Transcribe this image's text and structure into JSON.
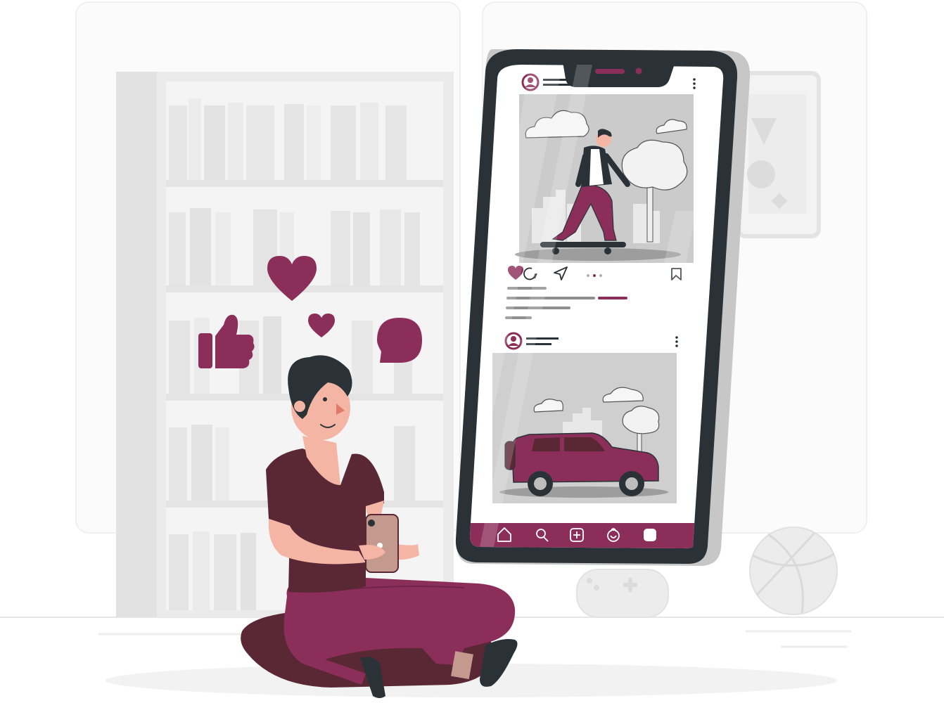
{
  "colors": {
    "primary": "#8b2f5a",
    "primary_dark": "#5a2735",
    "phone_frame": "#2a3237",
    "background_gray": "#ebebeb",
    "light_gray": "#f5f5f5",
    "skin": "#f4b5a4"
  },
  "post_actions": [
    "heart-icon",
    "comment-icon",
    "share-icon",
    "bookmark-icon"
  ],
  "bottom_nav": [
    "home-icon",
    "search-icon",
    "add-post-icon",
    "shop-icon",
    "profile-icon"
  ],
  "reactions": [
    "heart-icon",
    "thumbs-up-icon",
    "speech-bubble-icon"
  ],
  "posts": [
    {
      "subject": "skateboarder"
    },
    {
      "subject": "suv-car"
    }
  ]
}
